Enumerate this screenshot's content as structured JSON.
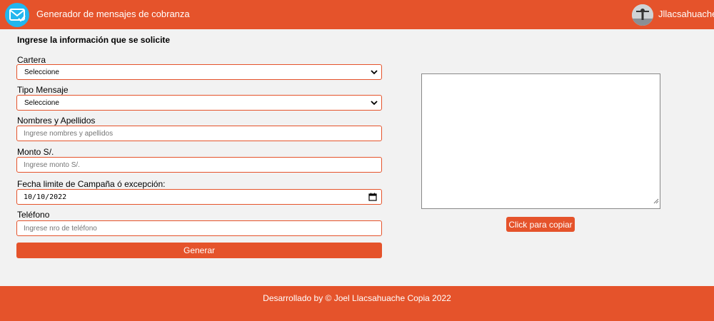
{
  "header": {
    "title": "Generador de mensajes de cobranza",
    "username": "Jllacsahuache",
    "logo_icon": "mail-check-icon",
    "accent_color": "#e5532b",
    "logo_color": "#22b6ee"
  },
  "form": {
    "heading": "Ingrese la información que se solicite",
    "cartera": {
      "label": "Cartera",
      "value": "Seleccione"
    },
    "tipo_mensaje": {
      "label": "Tipo Mensaje",
      "value": "Seleccione"
    },
    "nombres": {
      "label": "Nombres y Apellidos",
      "placeholder": "Ingrese nombres y apellidos"
    },
    "monto": {
      "label": "Monto S/.",
      "placeholder": "Ingrese monto S/."
    },
    "fecha": {
      "label": "Fecha limite de Campaña ó excepción:",
      "value": "10/10/2022"
    },
    "telefono": {
      "label": "Teléfono",
      "placeholder": "Ingrese nro de teléfono"
    },
    "generate_label": "Generar"
  },
  "output": {
    "message": "",
    "copy_label": "Click para copiar"
  },
  "footer": {
    "text": "Desarrollado by © Joel Llacsahuache Copia 2022"
  }
}
